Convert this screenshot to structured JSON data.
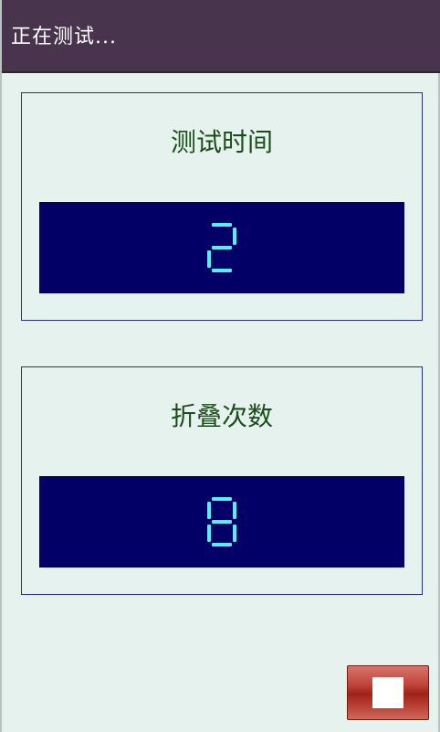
{
  "titlebar": {
    "title": "正在测试..."
  },
  "panels": [
    {
      "label": "测试时间",
      "value": "2"
    },
    {
      "label": "折叠次数",
      "value": "8"
    }
  ],
  "stop_button": {
    "icon": "stop-icon"
  },
  "colors": {
    "titlebar": "#48344c",
    "background": "#e6f2ee",
    "display_bg": "#020066",
    "digit": "#55f0f5",
    "label": "#1b4d1b",
    "stop_button": "#b53a2e"
  }
}
